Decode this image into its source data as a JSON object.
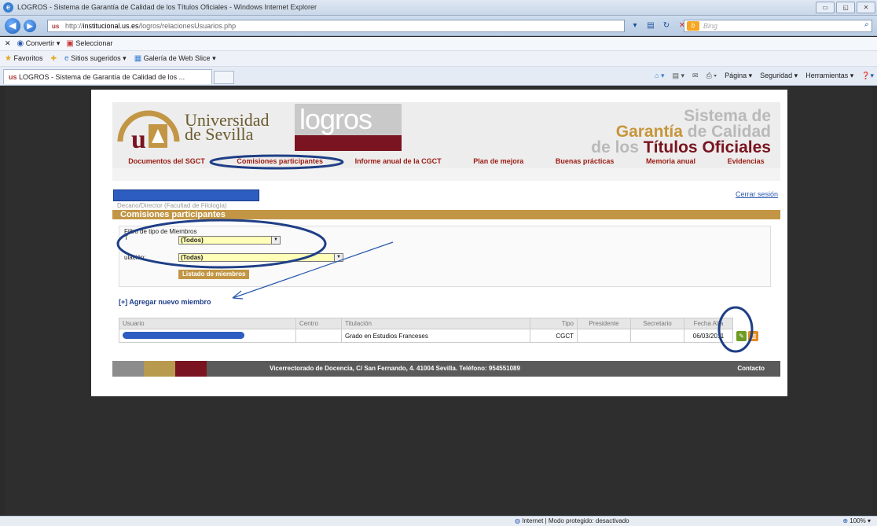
{
  "window": {
    "title": "LOGROS - Sistema de Garantía de Calidad de los Títulos Oficiales - Windows Internet Explorer"
  },
  "address": {
    "prefix": "http://",
    "host": "institucional.us.es",
    "path": "/logros/relacionesUsuarios.php",
    "search_placeholder": "Bing"
  },
  "commandbar": {
    "convert": "Convertir",
    "select": "Seleccionar"
  },
  "favbar": {
    "favorites": "Favoritos",
    "suggested": "Sitios sugeridos",
    "gallery": "Galería de Web Slice"
  },
  "tab": {
    "title": "LOGROS - Sistema de Garantía de Calidad de los ..."
  },
  "toolbar": {
    "page": "Página",
    "security": "Seguridad",
    "tools": "Herramientas"
  },
  "site": {
    "university_line1": "Universidad",
    "university_line2": "de Sevilla",
    "logros": "logros",
    "sys_line1": "Sistema de",
    "sys_line2a": "Garantía",
    "sys_line2b": "de Calidad",
    "sys_line3a": "de los",
    "sys_line3b": "Títulos Oficiales"
  },
  "menu": [
    "Documentos del SGCT",
    "Comisiones participantes",
    "Informe anual de la CGCT",
    "Plan de mejora",
    "Buenas prácticas",
    "Memoria anual",
    "Evidencias"
  ],
  "user": {
    "subtitle": "Decano/Director (Facultad de Filología)",
    "logout": "Cerrar sesión"
  },
  "section": {
    "title": "Comisiones participantes"
  },
  "filter": {
    "legend": "Filtro de tipo de Miembros",
    "type_label": "T",
    "type_value": "(Todos)",
    "titulacion_label": "ulación:",
    "titulacion_value": "(Todas)",
    "list_button": "Listado de miembros"
  },
  "add_member": "[+] Agregar nuevo miembro",
  "table": {
    "headers": [
      "Usuario",
      "Centro",
      "Titulación",
      "Tipo",
      "Presidente",
      "Secretario",
      "Fecha Alta"
    ],
    "rows": [
      {
        "centro": "",
        "titulacion": "Grado en Estudios Franceses",
        "tipo": "CGCT",
        "presidente": "",
        "secretario": "",
        "fecha": "06/03/2011"
      }
    ]
  },
  "footer": {
    "address": "Vicerrectorado de Docencia, C/ San Fernando, 4. 41004 Sevilla. Teléfono: 954551089",
    "contact": "Contacto"
  },
  "status": {
    "zone": "Internet | Modo protegido: desactivado",
    "zoom": "100%"
  },
  "colors": {
    "gold": "#c29645",
    "maroon": "#7a1420",
    "annotation": "#1f3f86"
  }
}
